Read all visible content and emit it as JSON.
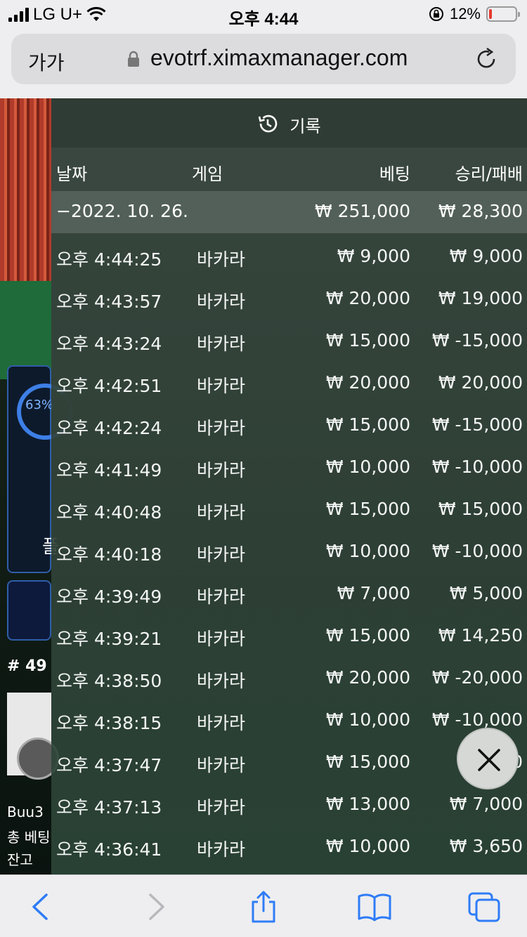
{
  "status_bar": {
    "carrier": "LG U+",
    "time": "오후 4:44",
    "battery": "12%",
    "battery_level": 0.12
  },
  "browser": {
    "text_size_button": "가가",
    "url": "evotrf.ximaxmanager.com"
  },
  "background_game": {
    "progress_text": "63%",
    "progress_value": 0.63,
    "panel_glyph": "플",
    "round": "# 49",
    "player_name": "Buu3",
    "total_bet_label": "총 베팅",
    "balance_label": "잔고"
  },
  "history": {
    "title": "기록",
    "columns": {
      "date": "날짜",
      "game": "게임",
      "bet": "베팅",
      "winloss": "승리/패배"
    },
    "day": {
      "date": "−2022. 10. 26.",
      "bet": "₩ 251,000",
      "winloss": "₩ 28,300"
    },
    "rows": [
      {
        "time": "오후 4:44:25",
        "game": "바카라",
        "bet": "₩ 9,000",
        "winloss": "₩ 9,000"
      },
      {
        "time": "오후 4:43:57",
        "game": "바카라",
        "bet": "₩ 20,000",
        "winloss": "₩ 19,000"
      },
      {
        "time": "오후 4:43:24",
        "game": "바카라",
        "bet": "₩ 15,000",
        "winloss": "₩ -15,000"
      },
      {
        "time": "오후 4:42:51",
        "game": "바카라",
        "bet": "₩ 20,000",
        "winloss": "₩ 20,000"
      },
      {
        "time": "오후 4:42:24",
        "game": "바카라",
        "bet": "₩ 15,000",
        "winloss": "₩ -15,000"
      },
      {
        "time": "오후 4:41:49",
        "game": "바카라",
        "bet": "₩ 10,000",
        "winloss": "₩ -10,000"
      },
      {
        "time": "오후 4:40:48",
        "game": "바카라",
        "bet": "₩ 15,000",
        "winloss": "₩ 15,000"
      },
      {
        "time": "오후 4:40:18",
        "game": "바카라",
        "bet": "₩ 10,000",
        "winloss": "₩ -10,000"
      },
      {
        "time": "오후 4:39:49",
        "game": "바카라",
        "bet": "₩ 7,000",
        "winloss": "₩ 5,000"
      },
      {
        "time": "오후 4:39:21",
        "game": "바카라",
        "bet": "₩ 15,000",
        "winloss": "₩ 14,250"
      },
      {
        "time": "오후 4:38:50",
        "game": "바카라",
        "bet": "₩ 20,000",
        "winloss": "₩ -20,000"
      },
      {
        "time": "오후 4:38:15",
        "game": "바카라",
        "bet": "₩ 10,000",
        "winloss": "₩ -10,000"
      },
      {
        "time": "오후 4:37:47",
        "game": "바카라",
        "bet": "₩ 15,000",
        "winloss": "₩ 0"
      },
      {
        "time": "오후 4:37:13",
        "game": "바카라",
        "bet": "₩ 13,000",
        "winloss": "₩ 7,000"
      },
      {
        "time": "오후 4:36:41",
        "game": "바카라",
        "bet": "₩ 10,000",
        "winloss": "₩ 3,650"
      }
    ]
  },
  "colors": {
    "accent_blue": "#2f7cf6",
    "battery_low": "#e53a30",
    "overlay": "#3a4840"
  }
}
